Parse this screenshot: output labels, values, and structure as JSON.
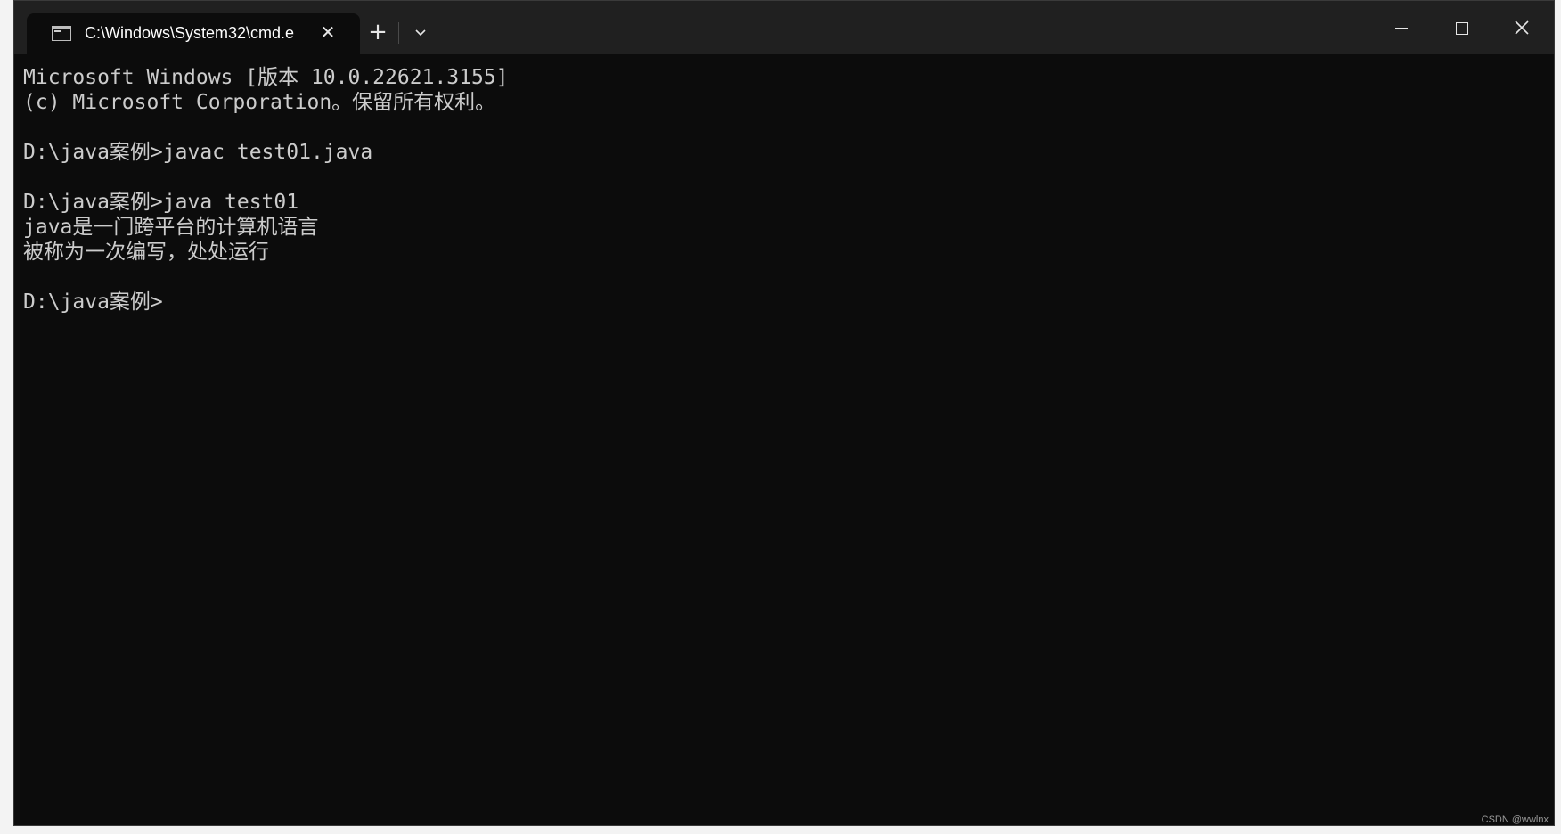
{
  "window": {
    "tab_title": "C:\\Windows\\System32\\cmd.e",
    "tab_icon": "cmd-prompt-icon",
    "new_tab_icon": "plus-icon",
    "dropdown_icon": "chevron-down-icon",
    "controls": [
      "minimize-icon",
      "maximize-icon",
      "close-icon"
    ]
  },
  "terminal": {
    "lines": [
      "Microsoft Windows [版本 10.0.22621.3155]",
      "(c) Microsoft Corporation。保留所有权利。",
      "",
      "D:\\java案例>javac test01.java",
      "",
      "D:\\java案例>java test01",
      "java是一门跨平台的计算机语言",
      "被称为一次编写，处处运行",
      "",
      "D:\\java案例>"
    ]
  },
  "watermark": "CSDN @wwlnx",
  "colors": {
    "terminal_bg": "#0c0c0c",
    "titlebar_bg": "#202020",
    "text": "#cccccc"
  }
}
